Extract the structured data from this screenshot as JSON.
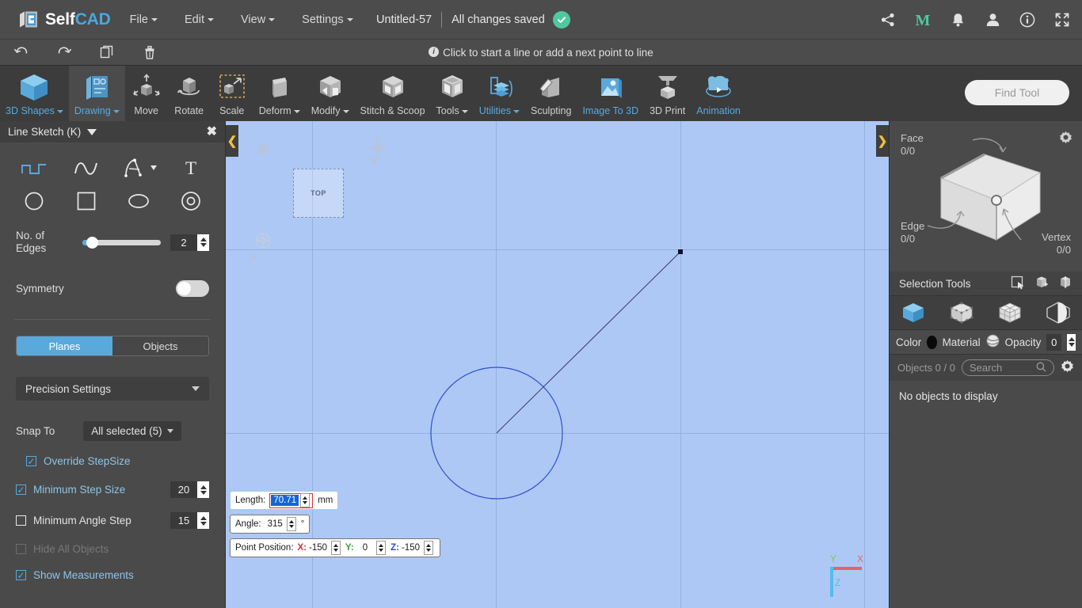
{
  "app": {
    "logo_self": "Self",
    "logo_cad": "CAD",
    "logo_icon": "selfcad-logo-icon"
  },
  "menubar": {
    "items": [
      {
        "label": "File",
        "has_caret": true
      },
      {
        "label": "Edit",
        "has_caret": true
      },
      {
        "label": "View",
        "has_caret": true
      },
      {
        "label": "Settings",
        "has_caret": true
      }
    ],
    "document_title": "Untitled-57",
    "save_status": "All changes saved",
    "save_icon": "check-circle-icon",
    "right_icons": [
      {
        "name": "share-icon"
      },
      {
        "name": "marketplace-m-icon",
        "color": "#4ec9a0"
      },
      {
        "name": "bell-notification-icon"
      },
      {
        "name": "user-account-icon"
      },
      {
        "name": "info-icon"
      },
      {
        "name": "fullscreen-expand-icon"
      }
    ]
  },
  "actionbar": {
    "buttons": [
      {
        "name": "undo-button",
        "icon": "undo-arrow-icon"
      },
      {
        "name": "redo-button",
        "icon": "redo-arrow-icon"
      },
      {
        "name": "copy-button",
        "icon": "copy-duplicate-icon"
      },
      {
        "name": "delete-button",
        "icon": "trash-bin-icon"
      }
    ],
    "hint": "Click to start a line or add a next point to line",
    "hint_icon": "info-icon"
  },
  "ribbon": {
    "items": [
      {
        "label": "3D Shapes",
        "icon": "cube-blue-icon",
        "caret": true,
        "active": false,
        "blue": false
      },
      {
        "label": "Drawing",
        "icon": "drawing-sketch-icon",
        "caret": true,
        "active": true,
        "blue": true
      },
      {
        "label": "Move",
        "icon": "move-arrows-icon",
        "caret": false,
        "active": false,
        "blue": false
      },
      {
        "label": "Rotate",
        "icon": "rotate-icon",
        "caret": false,
        "active": false,
        "blue": false
      },
      {
        "label": "Scale",
        "icon": "scale-icon",
        "caret": false,
        "active": false,
        "blue": false
      },
      {
        "label": "Deform",
        "icon": "deform-icon",
        "caret": true,
        "active": false,
        "blue": false
      },
      {
        "label": "Modify",
        "icon": "modify-icon",
        "caret": true,
        "active": false,
        "blue": false
      },
      {
        "label": "Stitch & Scoop",
        "icon": "stitch-scoop-icon",
        "caret": false,
        "active": false,
        "blue": false
      },
      {
        "label": "Tools",
        "icon": "tools-icon",
        "caret": true,
        "active": false,
        "blue": false
      },
      {
        "label": "Utilities",
        "icon": "utilities-icon",
        "caret": true,
        "active": false,
        "blue": true
      },
      {
        "label": "Sculpting",
        "icon": "sculpting-icon",
        "caret": false,
        "active": false,
        "blue": false
      },
      {
        "label": "Image To 3D",
        "icon": "image-to-3d-icon",
        "caret": false,
        "active": false,
        "blue": true
      },
      {
        "label": "3D Print",
        "icon": "3d-print-icon",
        "caret": false,
        "active": false,
        "blue": false
      },
      {
        "label": "Animation",
        "icon": "animation-icon",
        "caret": false,
        "active": false,
        "blue": true
      }
    ],
    "find_tool_placeholder": "Find Tool"
  },
  "left_panel": {
    "title": "Line Sketch (K)",
    "close_icon": "close-x-icon",
    "collapse_icon": "triangle-down-icon",
    "tools": [
      {
        "name": "polyline-tool",
        "icon": "polyline-step-icon",
        "active": true
      },
      {
        "name": "spline-tool",
        "icon": "spline-curve-icon",
        "active": false
      },
      {
        "name": "freehand-tool",
        "icon": "freehand-pen-icon",
        "active": false,
        "caret": true
      },
      {
        "name": "text-tool",
        "icon": "text-t-icon",
        "active": false
      },
      {
        "name": "circle-tool",
        "icon": "circle-outline-icon",
        "active": false
      },
      {
        "name": "square-tool",
        "icon": "square-outline-icon",
        "active": false
      },
      {
        "name": "ellipse-tool",
        "icon": "ellipse-outline-icon",
        "active": false
      },
      {
        "name": "concentric-tool",
        "icon": "concentric-circle-icon",
        "active": false
      }
    ],
    "edges": {
      "label": "No. of Edges",
      "value": "2",
      "slider_percent": 4
    },
    "symmetry": {
      "label": "Symmetry",
      "enabled": false
    },
    "segments": [
      {
        "label": "Planes",
        "active": true
      },
      {
        "label": "Objects",
        "active": false
      }
    ],
    "precision_settings": "Precision Settings",
    "snap_to": {
      "label": "Snap To",
      "value": "All selected (5)"
    },
    "checkboxes": [
      {
        "label": "Override StepSize",
        "checked": true,
        "disabled": false,
        "indented": true,
        "value": null
      },
      {
        "label": "Minimum Step Size",
        "checked": true,
        "disabled": false,
        "indented": false,
        "value": "20"
      },
      {
        "label": "Minimum Angle Step",
        "checked": false,
        "disabled": false,
        "indented": false,
        "value": "15"
      },
      {
        "label": "Hide All Objects",
        "checked": false,
        "disabled": true,
        "indented": false,
        "value": null
      },
      {
        "label": "Show Measurements",
        "checked": true,
        "disabled": false,
        "indented": false,
        "value": null
      }
    ]
  },
  "canvas": {
    "plane_label": "TOP",
    "home_icon": "home-icon",
    "view_cube_icon": "view-cube-icon",
    "orbit_icon": "orbit-target-icon",
    "left_collapse_icon": "chevron-left-icon",
    "right_collapse_icon": "chevron-right-icon",
    "axes": {
      "x": "X",
      "y": "Y",
      "z": "Z",
      "x_color": "#e06666",
      "y_color": "#77cc55",
      "z_color": "#55bbee"
    },
    "measurements": {
      "length": {
        "label": "Length:",
        "value": "70.71",
        "unit": "mm",
        "selected": true
      },
      "angle": {
        "label": "Angle:",
        "value": "315",
        "unit": "°"
      },
      "point_position": {
        "label": "Point Position:",
        "x_label": "X:",
        "x_value": "-150",
        "y_label": "Y:",
        "y_value": "0",
        "z_label": "Z:",
        "z_value": "-150"
      }
    }
  },
  "right_panel": {
    "selection": {
      "face_label": "Face",
      "face_count": "0/0",
      "edge_label": "Edge",
      "edge_count": "0/0",
      "vertex_label": "Vertex",
      "vertex_count": "0/0",
      "gear_icon": "settings-gear-icon",
      "box_icon": "selection-box-diagram"
    },
    "selection_tools": {
      "label": "Selection Tools",
      "icons": [
        {
          "name": "rectangle-select-icon"
        },
        {
          "name": "box-select-icon"
        },
        {
          "name": "through-select-icon"
        }
      ]
    },
    "modes": [
      {
        "name": "object-mode-icon",
        "active": true
      },
      {
        "name": "vertex-mode-icon",
        "active": false
      },
      {
        "name": "face-mode-icon",
        "active": false
      },
      {
        "name": "edge-mode-icon",
        "active": false
      }
    ],
    "appearance": {
      "color_label": "Color",
      "color_value": "#0a0a0a",
      "material_label": "Material",
      "material_icon": "material-sphere-icon",
      "opacity_label": "Opacity",
      "opacity_value": "0"
    },
    "objects": {
      "label": "Objects 0 / 0",
      "search_placeholder": "Search",
      "search_icon": "search-magnifier-icon",
      "gear_icon": "objects-settings-gear-icon",
      "empty_text": "No objects to display"
    }
  }
}
